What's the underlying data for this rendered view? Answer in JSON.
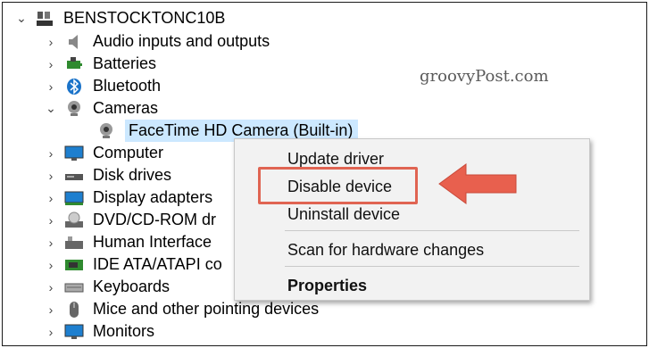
{
  "root": {
    "label": "BENSTOCKTONC10B",
    "icon": "computer-icon"
  },
  "categories": [
    {
      "label": "Audio inputs and outputs",
      "icon": "speaker-icon",
      "expanded": false
    },
    {
      "label": "Batteries",
      "icon": "battery-icon",
      "expanded": false
    },
    {
      "label": "Bluetooth",
      "icon": "bluetooth-icon",
      "expanded": false
    },
    {
      "label": "Cameras",
      "icon": "camera-icon",
      "expanded": true
    },
    {
      "label": "Computer",
      "icon": "monitor-icon",
      "expanded": false
    },
    {
      "label": "Disk drives",
      "icon": "disk-drive-icon",
      "expanded": false
    },
    {
      "label": "Display adapters",
      "icon": "display-adapter-icon",
      "expanded": false
    },
    {
      "label": "DVD/CD-ROM dr",
      "icon": "dvd-icon",
      "expanded": false
    },
    {
      "label": "Human Interface",
      "icon": "hid-icon",
      "expanded": false
    },
    {
      "label": "IDE ATA/ATAPI co",
      "icon": "ide-icon",
      "expanded": false
    },
    {
      "label": "Keyboards",
      "icon": "keyboard-icon",
      "expanded": false
    },
    {
      "label": "Mice and other pointing devices",
      "icon": "mouse-icon",
      "expanded": false
    },
    {
      "label": "Monitors",
      "icon": "monitor-icon",
      "expanded": false
    }
  ],
  "camera_device": {
    "label": "FaceTime HD Camera (Built-in)",
    "icon": "webcam-icon",
    "selected": true
  },
  "watermark": "groovyPost.com",
  "context_menu": {
    "items": [
      "Update driver",
      "Disable device",
      "Uninstall device",
      "Scan for hardware changes",
      "Properties"
    ],
    "highlighted_index": 1
  },
  "colors": {
    "selection": "#cce8ff",
    "highlight_box": "#e06452",
    "arrow": "#e8604e",
    "menu_bg": "#f2f2f2"
  }
}
